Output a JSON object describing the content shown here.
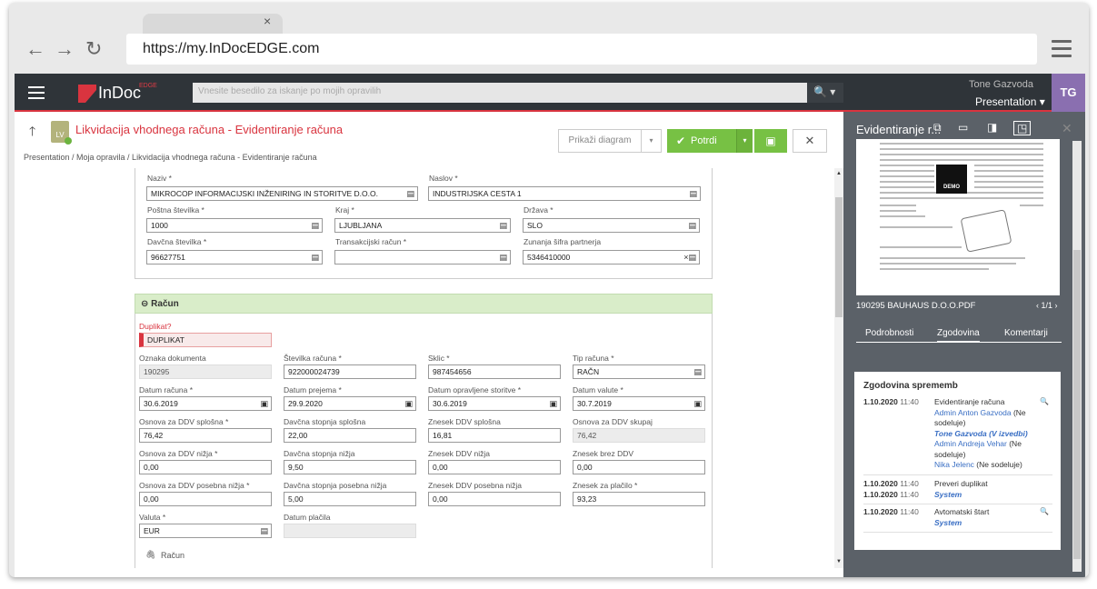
{
  "browser": {
    "url": "https://my.InDocEDGE.com",
    "tab_close": "×"
  },
  "topbar": {
    "logo": "InDoc",
    "logo_sup": "EDGE",
    "search_placeholder": "Vnesite besedilo za iskanje po mojih opravilih",
    "search_icon": "🔍 ▾",
    "user_name": "Tone Gazvoda",
    "user_role": "Presentation ▾",
    "avatar": "TG"
  },
  "header": {
    "title": "Likvidacija vhodnega računa - Evidentiranje računa",
    "badge": "LV",
    "breadcrumb": "Presentation  /  Moja opravila  /  Likvidacija vhodnega računa - Evidentiranje računa"
  },
  "toolbar": {
    "diagram": "Prikaži diagram",
    "confirm": "Potrdi"
  },
  "partner": {
    "naziv_label": "Naziv *",
    "naziv": "MIKROCOP INFORMACIJSKI INŽENIRING IN STORITVE D.O.O.",
    "naslov_label": "Naslov *",
    "naslov": "INDUSTRIJSKA CESTA 1",
    "posta_label": "Poštna številka *",
    "posta": "1000",
    "kraj_label": "Kraj *",
    "kraj": "LJUBLJANA",
    "drzava_label": "Država *",
    "drzava": "SLO",
    "davcna_label": "Davčna številka *",
    "davcna": "96627751",
    "trr_label": "Transakcijski račun *",
    "trr": "",
    "zunanja_label": "Zunanja šifra partnerja",
    "zunanja": "5346410000"
  },
  "racun": {
    "section": "Račun",
    "duplikat_label": "Duplikat?",
    "duplikat": "DUPLIKAT",
    "oznaka_label": "Oznaka dokumenta",
    "oznaka": "190295",
    "stevilka_label": "Številka računa *",
    "stevilka": "922000024739",
    "sklic_label": "Sklic *",
    "sklic": "987454656",
    "tip_label": "Tip računa *",
    "tip": "RAČN",
    "datum_racuna_label": "Datum računa *",
    "datum_racuna": "30.6.2019",
    "datum_prejema_label": "Datum prejema *",
    "datum_prejema": "29.9.2020",
    "datum_storitve_label": "Datum opravljene storitve *",
    "datum_storitve": "30.6.2019",
    "datum_valute_label": "Datum valute *",
    "datum_valute": "30.7.2019",
    "osnova_spl_label": "Osnova za DDV splošna *",
    "osnova_spl": "76,42",
    "stopnja_spl_label": "Davčna stopnja splošna",
    "stopnja_spl": "22,00",
    "znesek_spl_label": "Znesek DDV splošna",
    "znesek_spl": "16,81",
    "osnova_skupaj_label": "Osnova za DDV skupaj",
    "osnova_skupaj": "76,42",
    "osnova_niz_label": "Osnova za DDV nižja *",
    "osnova_niz": "0,00",
    "stopnja_niz_label": "Davčna stopnja nižja",
    "stopnja_niz": "9,50",
    "znesek_niz_label": "Znesek DDV nižja",
    "znesek_niz": "0,00",
    "brez_ddv_label": "Znesek brez DDV",
    "brez_ddv": "0,00",
    "osnova_pos_label": "Osnova za DDV posebna nižja *",
    "osnova_pos": "0,00",
    "stopnja_pos_label": "Davčna stopnja posebna nižja",
    "stopnja_pos": "5,00",
    "znesek_pos_label": "Znesek DDV posebna nižja",
    "znesek_pos": "0,00",
    "placilo_label": "Znesek za plačilo *",
    "placilo": "93,23",
    "valuta_label": "Valuta *",
    "valuta": "EUR",
    "datum_placila_label": "Datum plačila",
    "datum_placila": "",
    "attach_label": "Račun"
  },
  "panel": {
    "title": "Evidentiranje r...",
    "demo": "DEMO",
    "file": "190295 BAUHAUS D.O.O.PDF",
    "pages": "‹  1/1  ›",
    "tabs": [
      "Podrobnosti",
      "Zgodovina",
      "Komentarji"
    ],
    "history_title": "Zgodovina sprememb",
    "e1_date": "1.10.2020",
    "e1_time": "11:40",
    "e1_text": "Evidentiranje računa",
    "e1_l1": "Admin Anton Gazvoda",
    "e1_s1": " (Ne sodeluje)",
    "e1_l2": "Tone Gazvoda (V izvedbi)",
    "e1_l3": "Admin Andreja Vehar",
    "e1_s3": " (Ne sodeluje)",
    "e1_l4": "Nika Jelenc",
    "e1_s4": " (Ne sodeluje)",
    "e2_date": "1.10.2020",
    "e2_time": "11:40",
    "e2_text": "Preveri duplikat",
    "e2b_date": "1.10.2020",
    "e2b_time": "11:40",
    "e2b_text": "System",
    "e3_date": "1.10.2020",
    "e3_time": "11:40",
    "e3_text": "Avtomatski štart",
    "e3_sys": "System"
  }
}
